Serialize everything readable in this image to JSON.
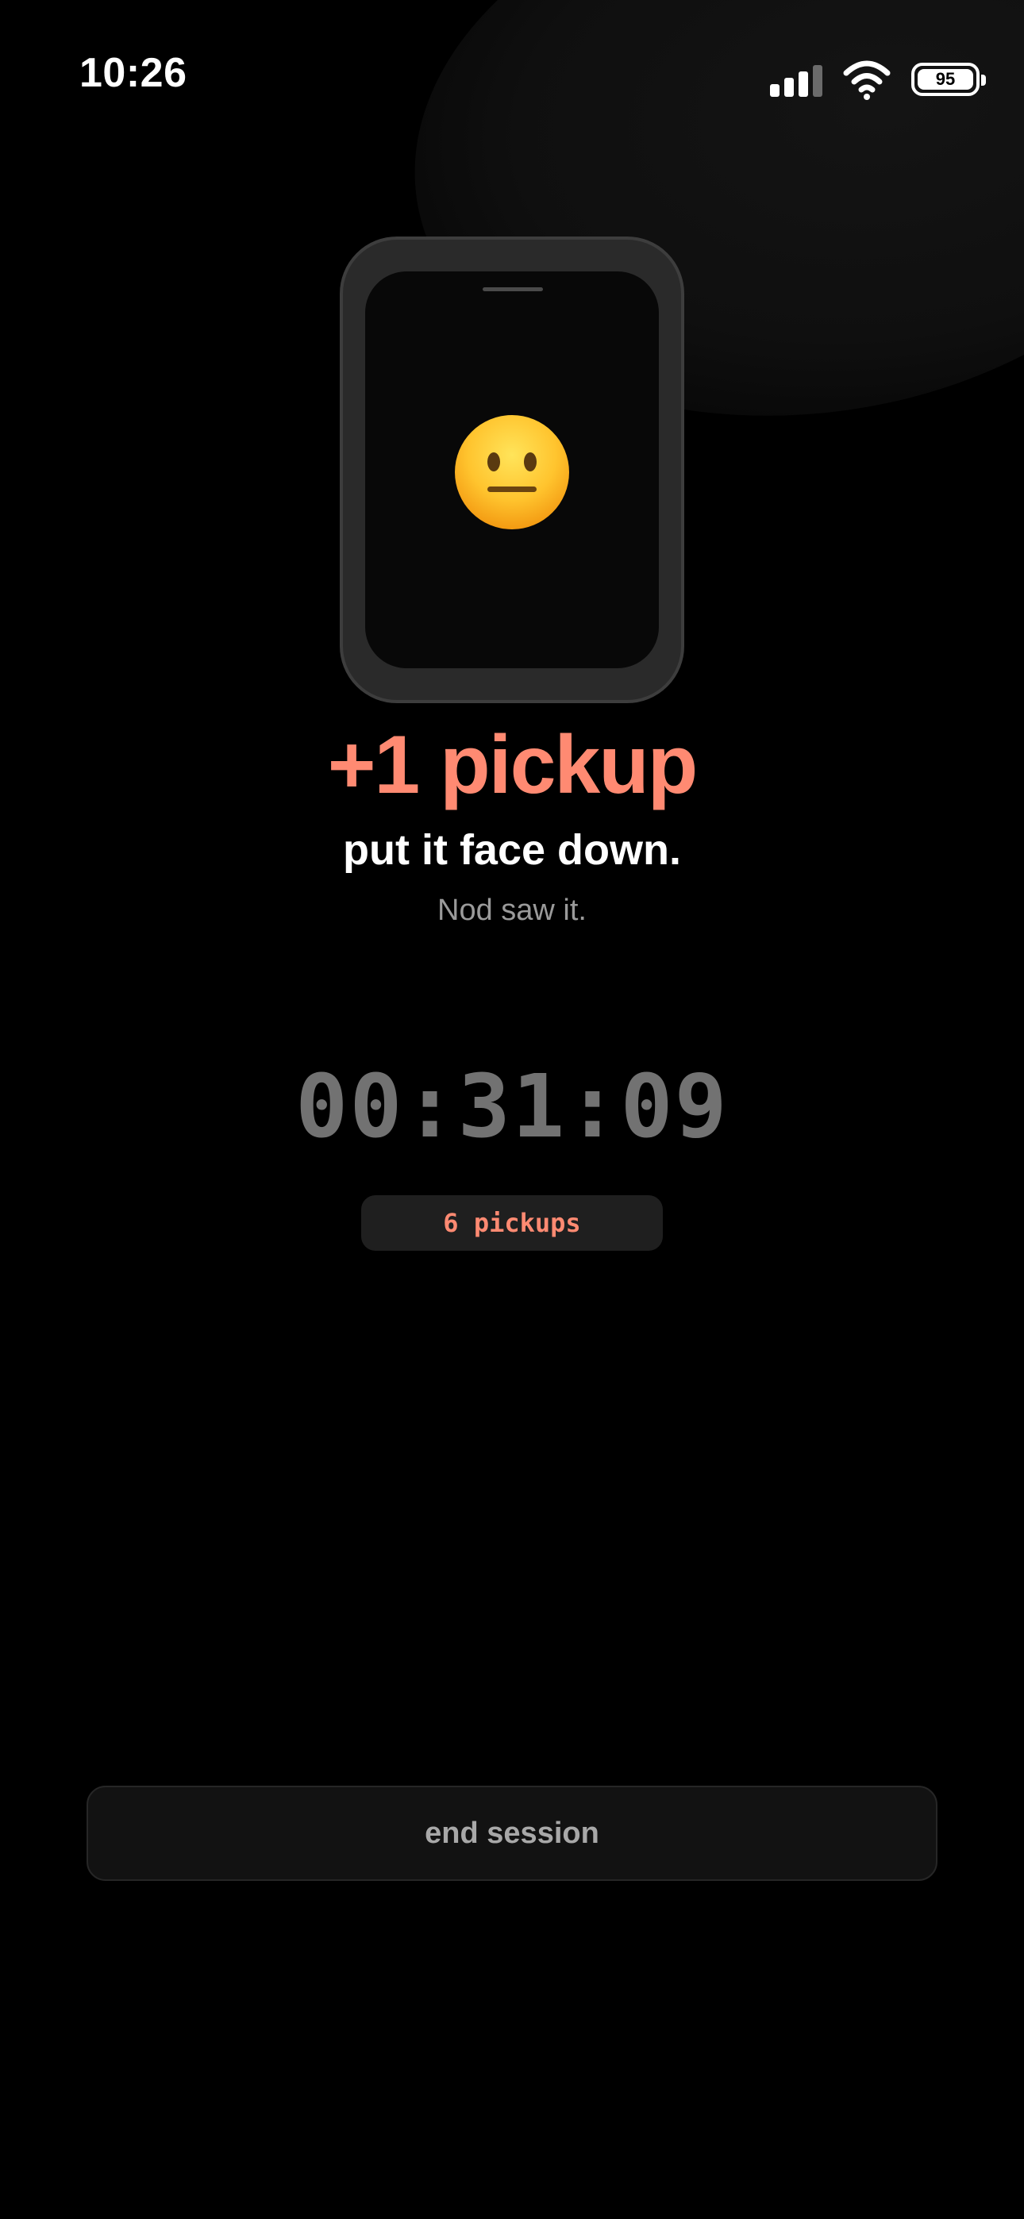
{
  "status_bar": {
    "time": "10:26",
    "battery_level": "95",
    "icons": [
      "cellular-signal-icon",
      "wifi-icon",
      "battery-icon"
    ]
  },
  "illustration": {
    "emoji_icon": "neutral-face-icon"
  },
  "alert": {
    "headline": "+1 pickup",
    "instruction": "put it face down.",
    "caption": "Nod saw it."
  },
  "session": {
    "timer": "00:31:09",
    "pickups_label": "6 pickups",
    "end_button_label": "end session"
  },
  "colors": {
    "accent": "#ff8a72",
    "background": "#000000",
    "timer_text": "#727272",
    "pill_bg": "#1f1f1f"
  }
}
